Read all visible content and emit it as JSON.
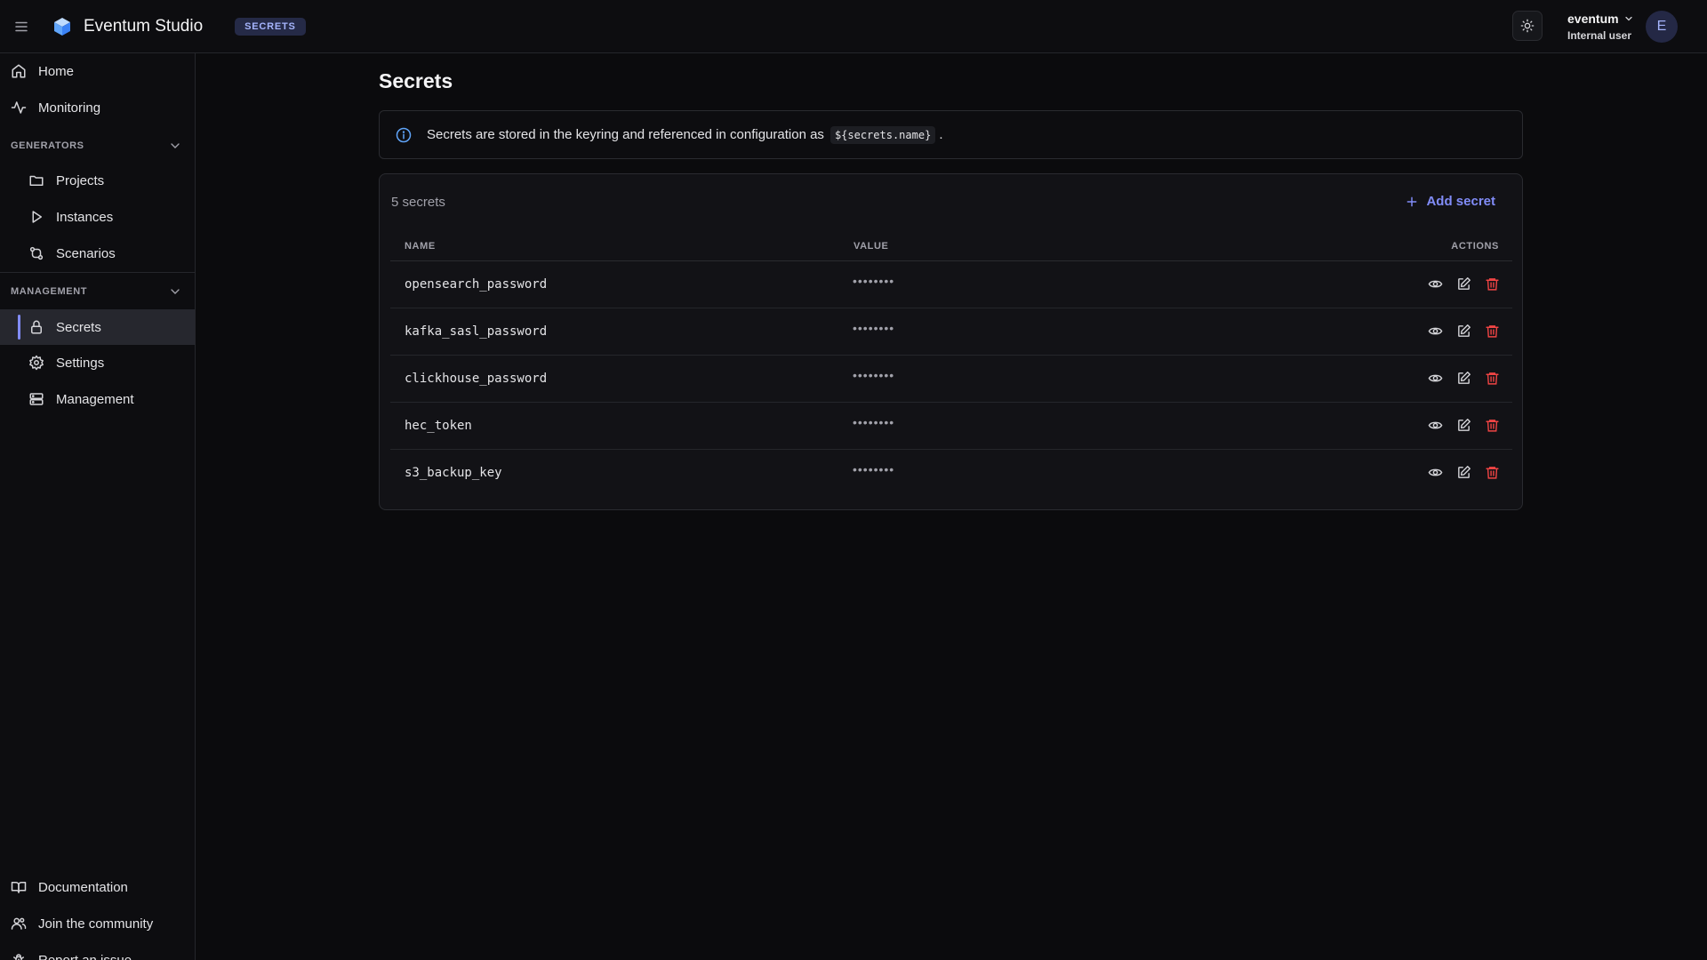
{
  "header": {
    "app_title": "Eventum Studio",
    "badge": "SECRETS",
    "user_name": "eventum",
    "user_role": "Internal user",
    "avatar_initial": "E"
  },
  "sidebar": {
    "top_items": [
      {
        "label": "Home",
        "icon": "home-icon"
      },
      {
        "label": "Monitoring",
        "icon": "activity-icon"
      }
    ],
    "generators": {
      "title": "GENERATORS",
      "items": [
        {
          "label": "Projects",
          "icon": "folder-icon"
        },
        {
          "label": "Instances",
          "icon": "play-icon"
        },
        {
          "label": "Scenarios",
          "icon": "scenarios-icon"
        }
      ]
    },
    "management": {
      "title": "MANAGEMENT",
      "items": [
        {
          "label": "Secrets",
          "icon": "lock-icon",
          "active": true
        },
        {
          "label": "Settings",
          "icon": "gear-icon"
        },
        {
          "label": "Management",
          "icon": "server-icon"
        }
      ]
    },
    "bottom_items": [
      {
        "label": "Documentation",
        "icon": "book-icon"
      },
      {
        "label": "Join the community",
        "icon": "users-icon"
      },
      {
        "label": "Report an issue",
        "icon": "bug-icon"
      }
    ]
  },
  "main": {
    "title": "Secrets",
    "info_text_before": "Secrets are stored in the keyring and referenced in configuration as",
    "info_code": "${secrets.name}",
    "info_text_after": ".",
    "count_label": "5 secrets",
    "add_label": "Add secret",
    "columns": {
      "name": "NAME",
      "value": "VALUE",
      "actions": "ACTIONS"
    },
    "rows": [
      {
        "name": "opensearch_password",
        "value": "••••••••"
      },
      {
        "name": "kafka_sasl_password",
        "value": "••••••••"
      },
      {
        "name": "clickhouse_password",
        "value": "••••••••"
      },
      {
        "name": "hec_token",
        "value": "••••••••"
      },
      {
        "name": "s3_backup_key",
        "value": "••••••••"
      }
    ]
  },
  "colors": {
    "accent": "#818cf8",
    "danger": "#ef4444",
    "info": "#60a5fa",
    "background": "#0b0b0d"
  }
}
